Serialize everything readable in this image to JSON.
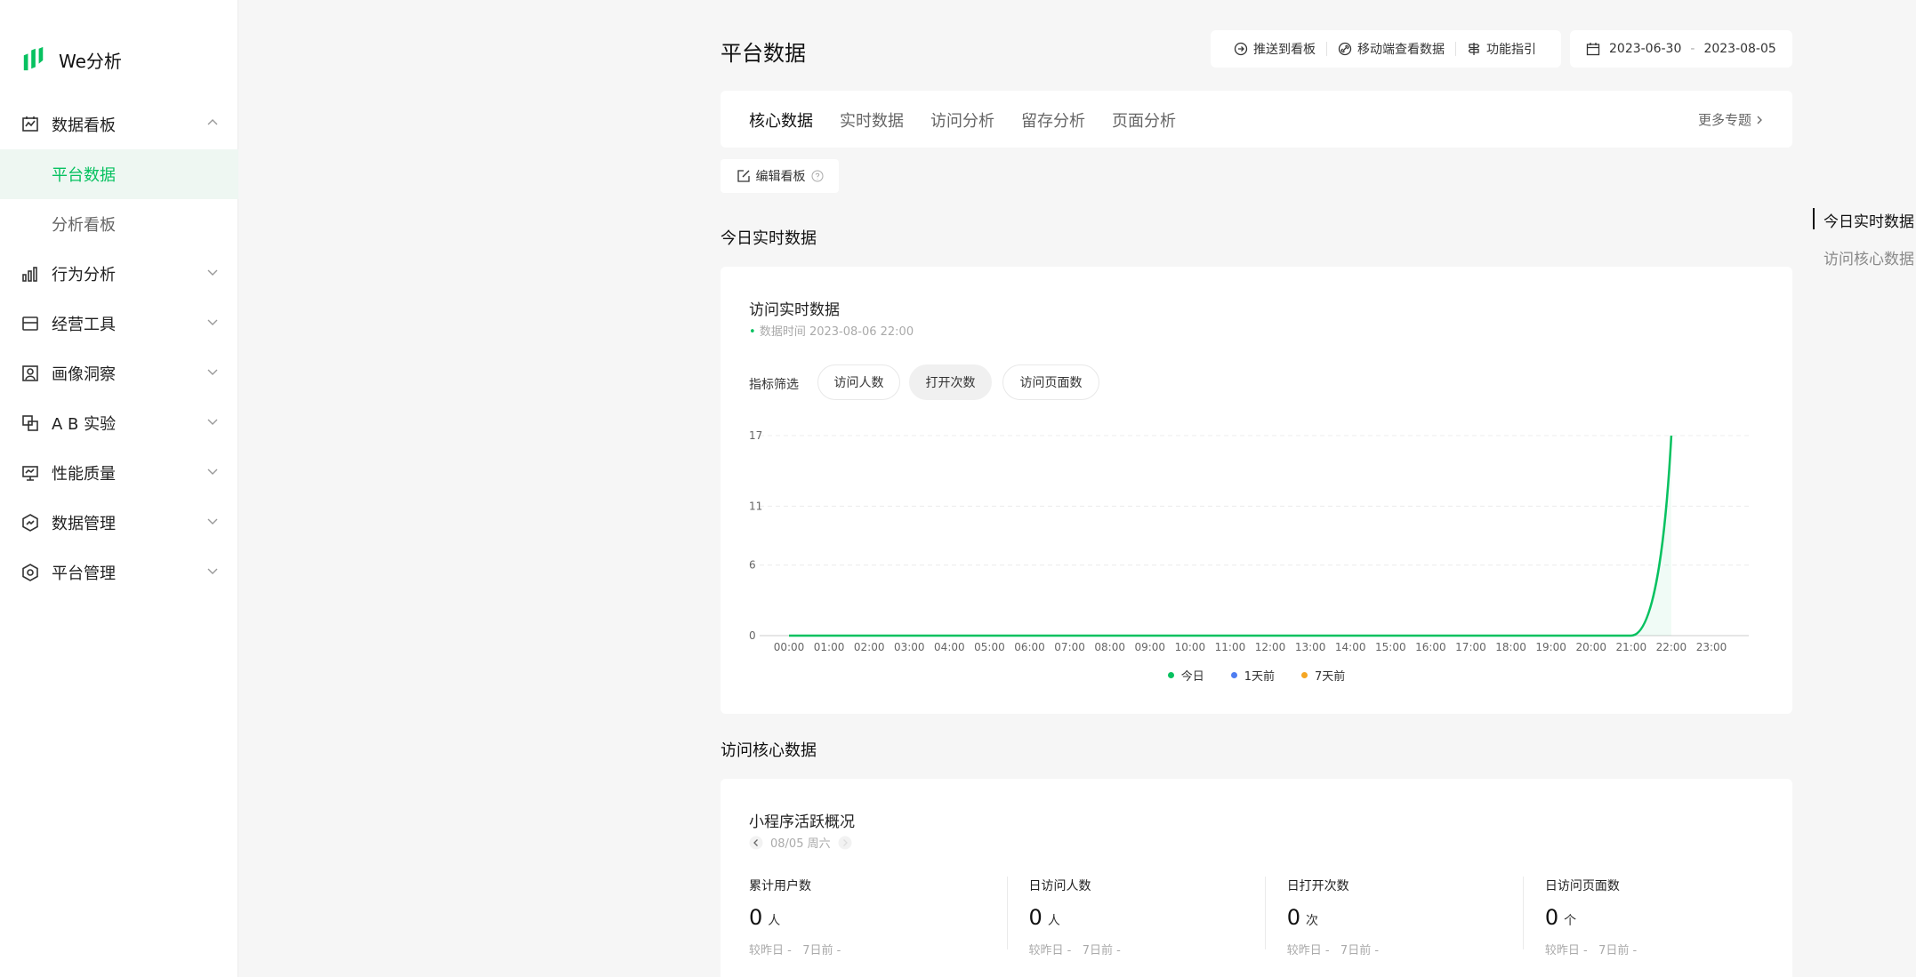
{
  "app": {
    "name": "We分析"
  },
  "sidebar": {
    "groups": [
      {
        "label": "数据看板",
        "icon": "dashboard-icon",
        "expanded": true,
        "items": [
          {
            "label": "平台数据",
            "active": true
          },
          {
            "label": "分析看板",
            "active": false
          }
        ]
      },
      {
        "label": "行为分析",
        "icon": "bar-chart-icon",
        "expanded": false
      },
      {
        "label": "经营工具",
        "icon": "store-icon",
        "expanded": false
      },
      {
        "label": "画像洞察",
        "icon": "portrait-icon",
        "expanded": false
      },
      {
        "label": "A B 实验",
        "icon": "ab-test-icon",
        "expanded": false
      },
      {
        "label": "性能质量",
        "icon": "monitor-icon",
        "expanded": false
      },
      {
        "label": "数据管理",
        "icon": "data-manage-icon",
        "expanded": false
      },
      {
        "label": "平台管理",
        "icon": "hexagon-settings-icon",
        "expanded": false
      }
    ]
  },
  "header": {
    "title": "平台数据",
    "tools": {
      "push": "推送到看板",
      "mobile": "移动端查看数据",
      "guide": "功能指引"
    },
    "date_range": {
      "start": "2023-06-30",
      "sep": "-",
      "end": "2023-08-05"
    }
  },
  "tabs": {
    "items": [
      {
        "label": "核心数据",
        "active": true
      },
      {
        "label": "实时数据"
      },
      {
        "label": "访问分析"
      },
      {
        "label": "留存分析"
      },
      {
        "label": "页面分析"
      }
    ],
    "more": "更多专题"
  },
  "edit_board": "编辑看板",
  "realtime": {
    "section_title": "今日实时数据",
    "card_title": "访问实时数据",
    "data_time": "数据时间 2023-08-06 22:00",
    "filter_label": "指标筛选",
    "filters": [
      {
        "label": "访问人数",
        "active": false
      },
      {
        "label": "打开次数",
        "active": true
      },
      {
        "label": "访问页面数",
        "active": false
      }
    ]
  },
  "chart_data": {
    "type": "line",
    "x": [
      "00:00",
      "01:00",
      "02:00",
      "03:00",
      "04:00",
      "05:00",
      "06:00",
      "07:00",
      "08:00",
      "09:00",
      "10:00",
      "11:00",
      "12:00",
      "13:00",
      "14:00",
      "15:00",
      "16:00",
      "17:00",
      "18:00",
      "19:00",
      "20:00",
      "21:00",
      "22:00",
      "23:00"
    ],
    "series": [
      {
        "name": "今日",
        "color": "#07c160",
        "values": [
          0,
          0,
          0,
          0,
          0,
          0,
          0,
          0,
          0,
          0,
          0,
          0,
          0,
          0,
          0,
          0,
          0,
          0,
          0,
          0,
          0,
          0,
          17,
          null
        ]
      },
      {
        "name": "1天前",
        "color": "#4e7df1",
        "values": []
      },
      {
        "name": "7天前",
        "color": "#f5a623",
        "values": []
      }
    ],
    "yticks": [
      0,
      6,
      11,
      17
    ],
    "ylim": [
      0,
      17
    ],
    "grid": true,
    "legend": "bottom-center"
  },
  "core": {
    "section_title": "访问核心数据",
    "card_title": "小程序活跃概况",
    "date_label": "08/05 周六",
    "metrics": [
      {
        "label": "累计用户数",
        "value": "0",
        "unit": "人",
        "cmp_day": "较昨日 -",
        "cmp_week": "7日前 -"
      },
      {
        "label": "日访问人数",
        "value": "0",
        "unit": "人",
        "cmp_day": "较昨日 -",
        "cmp_week": "7日前 -"
      },
      {
        "label": "日打开次数",
        "value": "0",
        "unit": "次",
        "cmp_day": "较昨日 -",
        "cmp_week": "7日前 -"
      },
      {
        "label": "日访问页面数",
        "value": "0",
        "unit": "个",
        "cmp_day": "较昨日 -",
        "cmp_week": "7日前 -"
      }
    ]
  },
  "anchor_nav": [
    {
      "label": "今日实时数据",
      "active": true
    },
    {
      "label": "访问核心数据",
      "active": false
    }
  ]
}
